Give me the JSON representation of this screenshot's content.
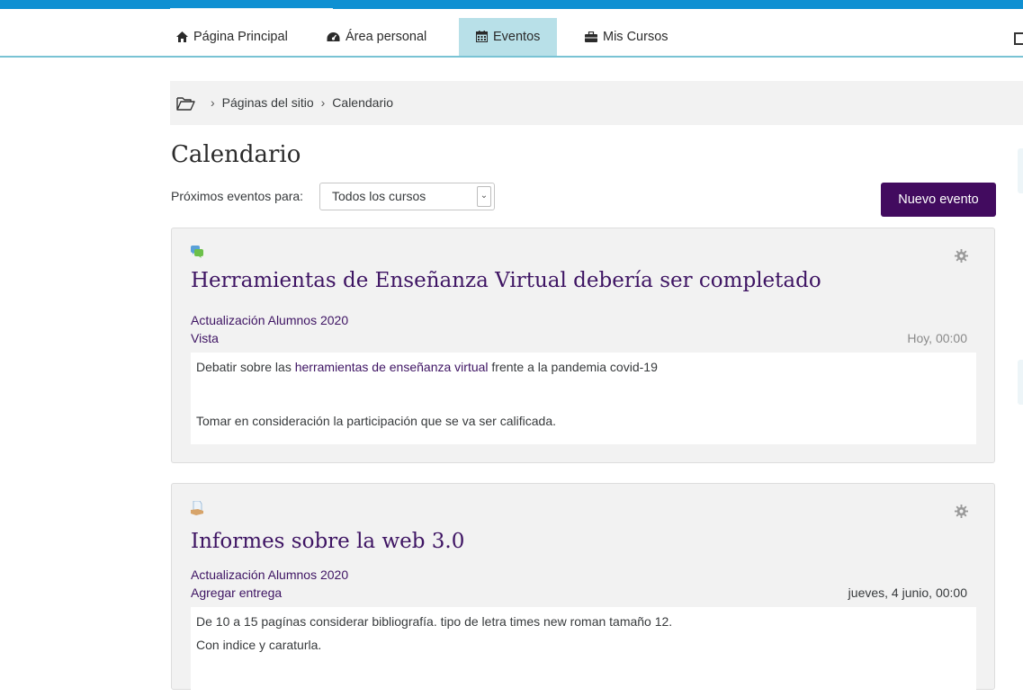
{
  "nav": {
    "items": [
      {
        "label": "Página Principal",
        "icon": "home-icon"
      },
      {
        "label": "Área personal",
        "icon": "dashboard-icon"
      },
      {
        "label": "Eventos",
        "icon": "calendar-icon",
        "active": true
      },
      {
        "label": "Mis Cursos",
        "icon": "briefcase-icon"
      }
    ]
  },
  "breadcrumb": {
    "items": [
      "Páginas del sitio",
      "Calendario"
    ]
  },
  "page": {
    "title": "Calendario",
    "filter_label": "Próximos eventos para:",
    "filter_value": "Todos los cursos",
    "new_event_label": "Nuevo evento"
  },
  "events": [
    {
      "title": "Herramientas de Enseñanza Virtual debería ser completado",
      "course": "Actualización Alumnos 2020",
      "action": "Vista",
      "date": "Hoy, 00:00",
      "icon": "forum-icon",
      "desc_before": "Debatir sobre las ",
      "desc_link": "herramientas de enseñanza virtual",
      "desc_after": " frente a la pandemia covid-19",
      "desc_line2": "Tomar en consideración la participación que se va ser calificada."
    },
    {
      "title": "Informes sobre la web 3.0",
      "course": "Actualización Alumnos 2020",
      "action": "Agregar entrega",
      "date": "jueves, 4 junio, 00:00",
      "icon": "assignment-icon",
      "desc_line1": "De 10 a 15 pagínas considerar bibliografía. tipo de letra times new roman tamaño 12.",
      "desc_line2": "Con indice y caraturla."
    }
  ],
  "colors": {
    "accent": "#0f90d2",
    "brand": "#420b5f",
    "link": "#3e1463",
    "nav_active": "#b8e0e8"
  }
}
